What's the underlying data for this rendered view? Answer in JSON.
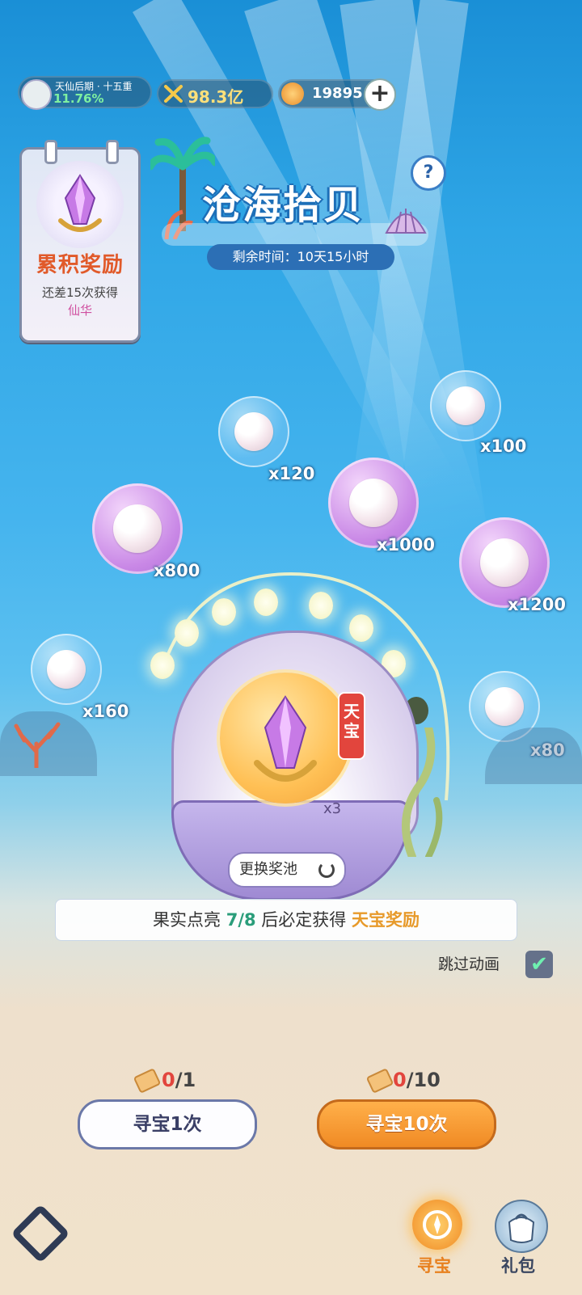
{
  "header": {
    "realm_title": "天仙后期 · 十五重",
    "realm_progress": "11.76%",
    "power_value": "98.3亿",
    "currency_value": "19895",
    "add_symbol": "+"
  },
  "cumulative": {
    "title": "累积奖励",
    "remaining_text": "还差15次获得",
    "reward_name": "仙华"
  },
  "event": {
    "title": "沧海拾贝",
    "timer_label": "剩余时间：10天15小时",
    "help_symbol": "?"
  },
  "bubbles": [
    {
      "qty": "x120",
      "color": "blue"
    },
    {
      "qty": "x100",
      "color": "blue"
    },
    {
      "qty": "x800",
      "color": "purple"
    },
    {
      "qty": "x1000",
      "color": "purple"
    },
    {
      "qty": "x1200",
      "color": "purple"
    },
    {
      "qty": "x160",
      "color": "blue"
    },
    {
      "qty": "x80",
      "color": "blue"
    }
  ],
  "grand_prize": {
    "tag": "天宝",
    "multiplier": "x3",
    "swap_label": "更换奖池"
  },
  "notice": {
    "prefix": "果实点亮",
    "progress": "7/8",
    "middle": "后必定获得",
    "reward": "天宝奖励"
  },
  "skip_animation": {
    "label": "跳过动画",
    "checked": true,
    "check_symbol": "✔"
  },
  "draw_single": {
    "count_owned": "0",
    "count_needed": "/1",
    "button_label": "寻宝1次"
  },
  "draw_ten": {
    "count_owned": "0",
    "count_needed": "/10",
    "button_label": "寻宝10次"
  },
  "nav": {
    "treasure_label": "寻宝",
    "gift_label": "礼包"
  },
  "colors": {
    "accent_orange": "#f08a24",
    "tag_red": "#e2453d",
    "progress_green": "#2a9d7a"
  }
}
